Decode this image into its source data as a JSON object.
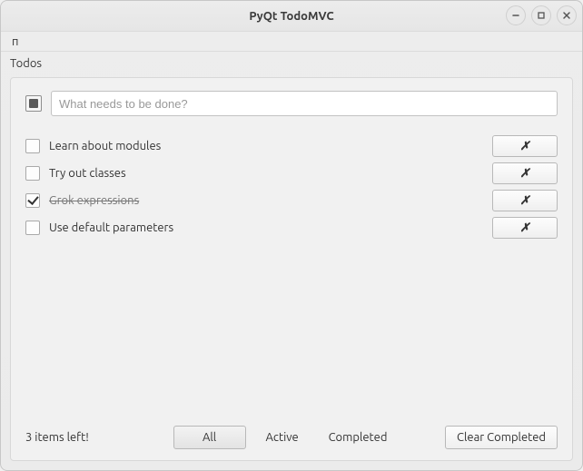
{
  "window": {
    "title": "PyQt TodoMVC"
  },
  "menu": {
    "item1": "π"
  },
  "header": "Todos",
  "new_todo": {
    "placeholder": "What needs to be done?",
    "value": ""
  },
  "todos": [
    {
      "label": "Learn about modules",
      "completed": false,
      "delete_glyph": "✗"
    },
    {
      "label": "Try out classes",
      "completed": false,
      "delete_glyph": "✗"
    },
    {
      "label": "Grok expressions",
      "completed": true,
      "delete_glyph": "✗"
    },
    {
      "label": "Use default parameters",
      "completed": false,
      "delete_glyph": "✗"
    }
  ],
  "footer": {
    "count_text": "3 items left!",
    "filters": {
      "all": "All",
      "active": "Active",
      "completed": "Completed",
      "selected": "all"
    },
    "clear_label": "Clear Completed"
  }
}
